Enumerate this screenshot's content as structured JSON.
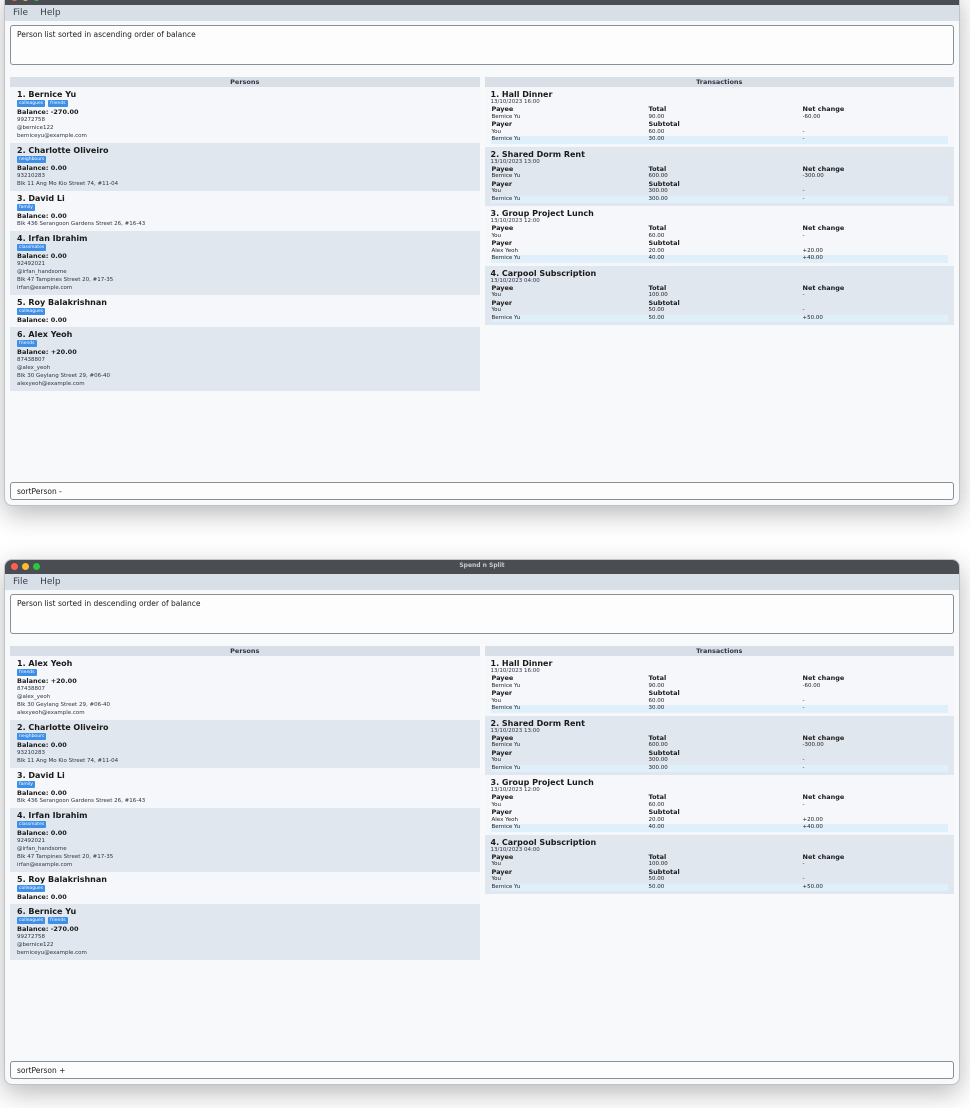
{
  "app": {
    "title": "Spend n Split",
    "menu": [
      "File",
      "Help"
    ]
  },
  "panels": {
    "persons_title": "Persons",
    "transactions_title": "Transactions"
  },
  "labels": {
    "payee": "Payee",
    "payer": "Payer",
    "total": "Total",
    "subtotal": "Subtotal",
    "net_change": "Net change"
  },
  "transactions": [
    {
      "name": "1. Hall Dinner",
      "date": "13/10/2023 16:00",
      "payee": {
        "name": "Bernice Yu",
        "total": "90.00",
        "net": "-60.00"
      },
      "payers": [
        {
          "name": "You",
          "sub": "60.00",
          "net": "-"
        },
        {
          "name": "Bernice Yu",
          "sub": "30.00",
          "net": "-"
        }
      ]
    },
    {
      "name": "2. Shared Dorm Rent",
      "date": "13/10/2023 13:00",
      "payee": {
        "name": "Bernice Yu",
        "total": "600.00",
        "net": "-300.00"
      },
      "payers": [
        {
          "name": "You",
          "sub": "300.00",
          "net": "-"
        },
        {
          "name": "Bernice Yu",
          "sub": "300.00",
          "net": "-"
        }
      ]
    },
    {
      "name": "3. Group Project Lunch",
      "date": "13/10/2023 12:00",
      "payee": {
        "name": "You",
        "total": "60.00",
        "net": "-"
      },
      "payers": [
        {
          "name": "Alex Yeoh",
          "sub": "20.00",
          "net": "+20.00"
        },
        {
          "name": "Bernice Yu",
          "sub": "40.00",
          "net": "+40.00"
        }
      ]
    },
    {
      "name": "4. Carpool Subscription",
      "date": "13/10/2023 04:00",
      "payee": {
        "name": "You",
        "total": "100.00",
        "net": "-"
      },
      "payers": [
        {
          "name": "You",
          "sub": "50.00",
          "net": "-"
        },
        {
          "name": "Bernice Yu",
          "sub": "50.00",
          "net": "+50.00"
        }
      ]
    }
  ],
  "windows": [
    {
      "result": "Person list sorted in ascending order of balance",
      "command": "sortPerson -",
      "persons": [
        {
          "name": "1. Bernice Yu",
          "tags": [
            "colleagues",
            "friends"
          ],
          "balance": "Balance: -270.00",
          "lines": [
            "99272758",
            "@bernice122",
            "berniceyu@example.com"
          ]
        },
        {
          "name": "2. Charlotte Oliveiro",
          "tags": [
            "neighbours"
          ],
          "balance": "Balance: 0.00",
          "lines": [
            "93210283",
            "Blk 11 Ang Mo Kio Street 74, #11-04"
          ]
        },
        {
          "name": "3. David Li",
          "tags": [
            "family"
          ],
          "balance": "Balance: 0.00",
          "lines": [
            "Blk 436 Serangoon Gardens Street 26, #16-43"
          ]
        },
        {
          "name": "4. Irfan Ibrahim",
          "tags": [
            "classmates"
          ],
          "balance": "Balance: 0.00",
          "lines": [
            "92492021",
            "@irfan_handsome",
            "Blk 47 Tampines Street 20, #17-35",
            "irfan@example.com"
          ]
        },
        {
          "name": "5. Roy Balakrishnan",
          "tags": [
            "colleagues"
          ],
          "balance": "Balance: 0.00",
          "lines": []
        },
        {
          "name": "6. Alex Yeoh",
          "tags": [
            "friends"
          ],
          "balance": "Balance: +20.00",
          "lines": [
            "87438807",
            "@alex_yeoh",
            "Blk 30 Geylang Street 29, #06-40",
            "alexyeoh@example.com"
          ]
        }
      ]
    },
    {
      "result": "Person list sorted in descending order of balance",
      "command": "sortPerson +",
      "persons": [
        {
          "name": "1. Alex Yeoh",
          "tags": [
            "friends"
          ],
          "balance": "Balance: +20.00",
          "lines": [
            "87438807",
            "@alex_yeoh",
            "Blk 30 Geylang Street 29, #06-40",
            "alexyeoh@example.com"
          ]
        },
        {
          "name": "2. Charlotte Oliveiro",
          "tags": [
            "neighbours"
          ],
          "balance": "Balance: 0.00",
          "lines": [
            "93210283",
            "Blk 11 Ang Mo Kio Street 74, #11-04"
          ]
        },
        {
          "name": "3. David Li",
          "tags": [
            "family"
          ],
          "balance": "Balance: 0.00",
          "lines": [
            "Blk 436 Serangoon Gardens Street 26, #16-43"
          ]
        },
        {
          "name": "4. Irfan Ibrahim",
          "tags": [
            "classmates"
          ],
          "balance": "Balance: 0.00",
          "lines": [
            "92492021",
            "@irfan_handsome",
            "Blk 47 Tampines Street 20, #17-35",
            "irfan@example.com"
          ]
        },
        {
          "name": "5. Roy Balakrishnan",
          "tags": [
            "colleagues"
          ],
          "balance": "Balance: 0.00",
          "lines": []
        },
        {
          "name": "6. Bernice Yu",
          "tags": [
            "colleagues",
            "friends"
          ],
          "balance": "Balance: -270.00",
          "lines": [
            "99272758",
            "@bernice122",
            "berniceyu@example.com"
          ]
        }
      ]
    }
  ],
  "colors": {
    "tag": "#3d8fe8",
    "header": "#d9dfe7",
    "card_alt": "#e1e7ef",
    "row_highlight": "#dff0fb"
  }
}
